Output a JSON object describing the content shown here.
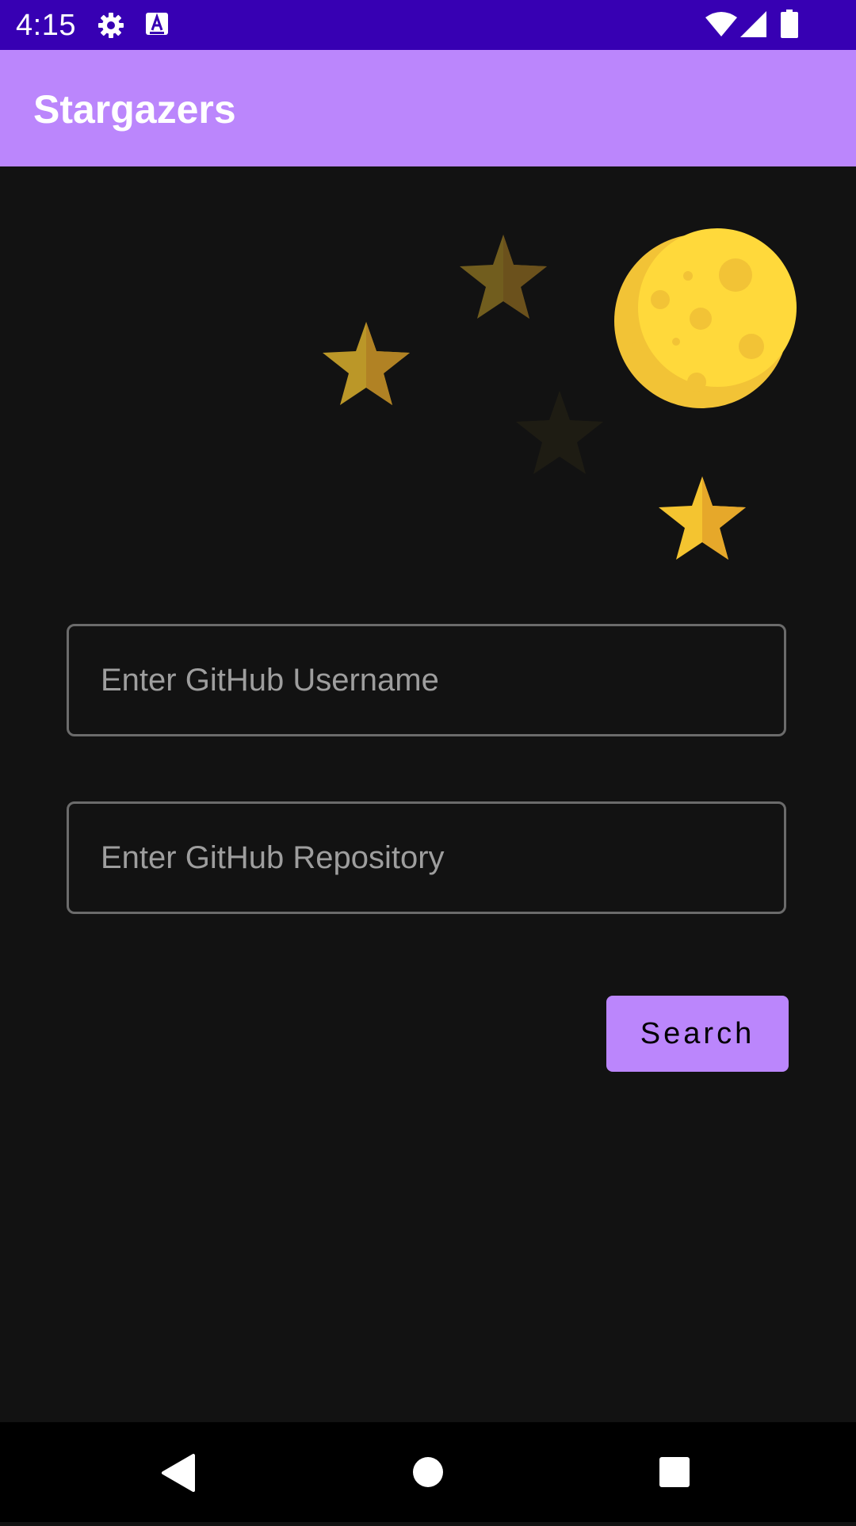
{
  "status_bar": {
    "time": "4:15",
    "icons": [
      "gear-icon",
      "text-a-icon",
      "wifi-icon",
      "cell-signal-icon",
      "battery-icon"
    ],
    "background": "#3700b3"
  },
  "app_bar": {
    "title": "Stargazers",
    "background": "#bb86fc"
  },
  "illustration": {
    "icons": [
      "moon-icon",
      "star-icon",
      "star-icon",
      "star-icon",
      "star-icon"
    ],
    "moon_color": "#ffd93b",
    "star_color": "#f4c430"
  },
  "form": {
    "username_placeholder": "Enter GitHub Username",
    "repository_placeholder": "Enter GitHub Repository",
    "search_label": "Search",
    "accent": "#bb86fc"
  },
  "nav_bar": {
    "icons": [
      "back-icon",
      "home-icon",
      "recents-icon"
    ]
  }
}
